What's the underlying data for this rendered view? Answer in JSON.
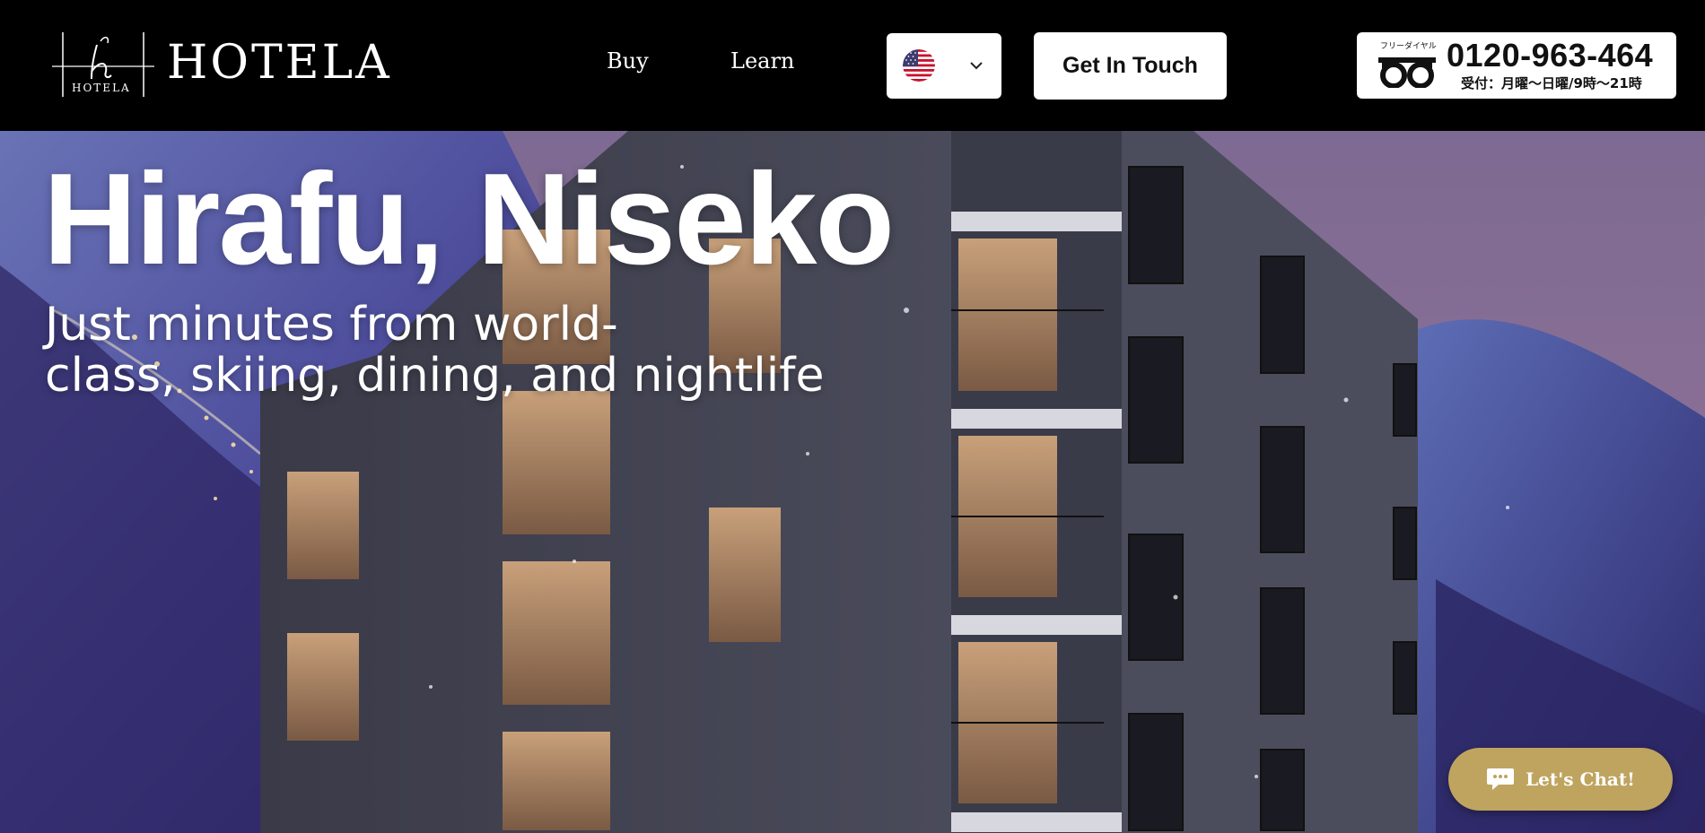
{
  "brand": {
    "name": "HOTELA",
    "mark_label": "HOTELA"
  },
  "nav": {
    "items": [
      {
        "label": "Buy"
      },
      {
        "label": "Learn"
      }
    ]
  },
  "language": {
    "selected": "English (US)",
    "flag": "us-flag-icon"
  },
  "header": {
    "cta_label": "Get In Touch"
  },
  "phone": {
    "badge": "フリーダイヤル",
    "number": "0120-963-464",
    "hours": "受付：月曜～日曜/9時～21時",
    "icon": "freedial-icon"
  },
  "hero": {
    "title": "Hirafu, Niseko",
    "subtitle_line1": "Just minutes from world-",
    "subtitle_line2": "class, skiing, dining, and nightlife"
  },
  "chat": {
    "label": "Let's Chat!",
    "icon": "chat-bubble-icon"
  },
  "colors": {
    "header_bg": "#000000",
    "chat_bg": "#bfa45f",
    "button_bg": "#ffffff"
  }
}
